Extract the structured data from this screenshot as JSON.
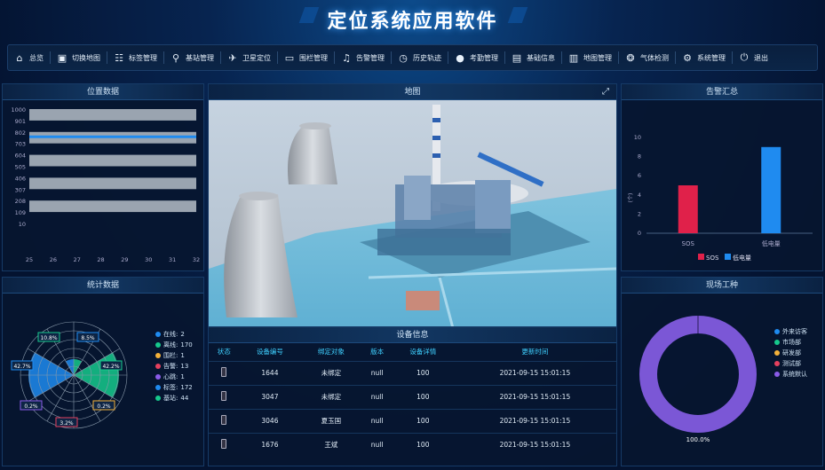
{
  "app": {
    "title": "定位系统应用软件"
  },
  "nav": [
    {
      "label": "总览",
      "icon": "home-icon"
    },
    {
      "label": "切换地图",
      "icon": "map-switch-icon"
    },
    {
      "label": "标签管理",
      "icon": "tag-icon"
    },
    {
      "label": "基站管理",
      "icon": "antenna-icon"
    },
    {
      "label": "卫星定位",
      "icon": "satellite-icon"
    },
    {
      "label": "围栏管理",
      "icon": "fence-icon"
    },
    {
      "label": "告警管理",
      "icon": "alarm-icon"
    },
    {
      "label": "历史轨迹",
      "icon": "history-icon"
    },
    {
      "label": "考勤管理",
      "icon": "attendance-icon"
    },
    {
      "label": "基础信息",
      "icon": "info-icon"
    },
    {
      "label": "地图管理",
      "icon": "map-icon"
    },
    {
      "label": "气体检测",
      "icon": "gas-icon"
    },
    {
      "label": "系统管理",
      "icon": "gear-icon"
    },
    {
      "label": "退出",
      "icon": "power-icon"
    }
  ],
  "panels": {
    "position": "位置数据",
    "map": "地图",
    "alarm": "告警汇总",
    "stats": "统计数据",
    "device": "设备信息",
    "workers": "现场工种"
  },
  "position_chart": {
    "y_ticks": [
      "1000",
      "901",
      "802",
      "703",
      "604",
      "505",
      "406",
      "307",
      "208",
      "109",
      "10"
    ],
    "x_ticks": [
      "25",
      "26",
      "27",
      "28",
      "29",
      "30",
      "31",
      "32"
    ],
    "line_value": 760
  },
  "alarm_chart": {
    "type": "bar",
    "ylabel": "(个)",
    "y_ticks": [
      "10",
      "8",
      "6",
      "4",
      "2",
      "0"
    ],
    "ylim": [
      0,
      10
    ],
    "categories": [
      "SOS",
      "低电量"
    ],
    "values": [
      5,
      9
    ],
    "colors": [
      "#e0214a",
      "#1f8bf0"
    ],
    "legend": [
      "SOS",
      "低电量"
    ]
  },
  "stats": {
    "legend": [
      {
        "label": "在线:",
        "value": "2",
        "color": "#1f8bf0"
      },
      {
        "label": "离线:",
        "value": "170",
        "color": "#16c98c"
      },
      {
        "label": "围栏:",
        "value": "1",
        "color": "#f3b13a"
      },
      {
        "label": "告警:",
        "value": "13",
        "color": "#e5405e"
      },
      {
        "label": "心跳:",
        "value": "1",
        "color": "#8a5be8"
      },
      {
        "label": "标签:",
        "value": "172",
        "color": "#1f8bf0"
      },
      {
        "label": "基站:",
        "value": "44",
        "color": "#16c98c"
      }
    ],
    "badges": [
      "10.8%",
      "8.5%",
      "42.7%",
      "42.2%",
      "0.2%",
      "0.2%",
      "3.2%"
    ]
  },
  "devices": {
    "columns": [
      "状态",
      "设备编号",
      "绑定对象",
      "版本",
      "设备详情",
      "更新时间"
    ],
    "rows": [
      [
        "",
        "1644",
        "未绑定",
        "null",
        "100",
        "2021-09-15 15:01:15"
      ],
      [
        "",
        "3047",
        "未绑定",
        "null",
        "100",
        "2021-09-15 15:01:15"
      ],
      [
        "",
        "3046",
        "夏玉国",
        "null",
        "100",
        "2021-09-15 15:01:15"
      ],
      [
        "",
        "1676",
        "王斌",
        "null",
        "100",
        "2021-09-15 15:01:15"
      ]
    ]
  },
  "workers": {
    "legend": [
      {
        "label": "外来访客",
        "color": "#1f8bf0"
      },
      {
        "label": "市场部",
        "color": "#16c98c"
      },
      {
        "label": "研发部",
        "color": "#f3b13a"
      },
      {
        "label": "测试部",
        "color": "#e5405e"
      },
      {
        "label": "系统默认",
        "color": "#8a5be8"
      }
    ],
    "values": [
      0,
      0,
      0,
      0,
      100
    ],
    "label": "100.0%"
  }
}
